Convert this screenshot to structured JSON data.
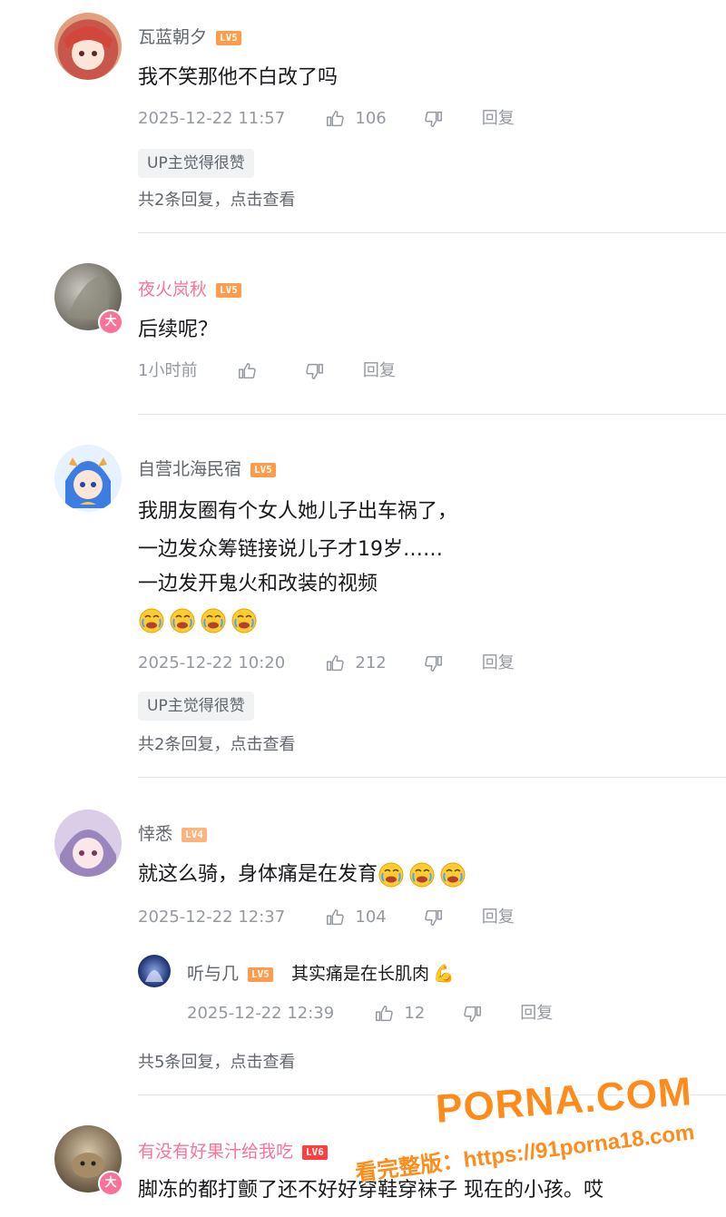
{
  "comments": [
    {
      "username": "瓦蓝朝夕",
      "level": "LV5",
      "text": "我不笑那他不白改了吗",
      "time": "2025-12-22 11:57",
      "likes": "106",
      "reply_label": "回复",
      "up_tag": "UP主觉得很赞",
      "more": "共2条回复，点击查看"
    },
    {
      "username": "夜火岚秋",
      "level": "LV5",
      "text": "后续呢？",
      "time": "1小时前",
      "reply_label": "回复",
      "badge": "大"
    },
    {
      "username": "自营北海民宿",
      "level": "LV5",
      "lines": [
        "我朋友圈有个女人她儿子出车祸了，",
        "一边发众筹链接说儿子才19岁……",
        "一边发开鬼火和改装的视频"
      ],
      "time": "2025-12-22 10:20",
      "likes": "212",
      "reply_label": "回复",
      "up_tag": "UP主觉得很赞",
      "more": "共2条回复，点击查看"
    },
    {
      "username": "悻悉",
      "level": "LV4",
      "text": "就这么骑，身体痛是在发育",
      "time": "2025-12-22 12:37",
      "likes": "104",
      "reply_label": "回复",
      "reply": {
        "username": "听与几",
        "level": "LV5",
        "text": "其实痛是在长肌肉",
        "time": "2025-12-22 12:39",
        "likes": "12",
        "reply_label": "回复"
      },
      "more": "共5条回复，点击查看"
    },
    {
      "username": "有没有好果汁给我吃",
      "level": "LV6",
      "badge": "大",
      "text": "脚冻的都打颤了还不好好穿鞋穿袜子 现在的小孩。哎"
    }
  ],
  "watermark": {
    "brand": "PORNA.COM",
    "url_line": "看完整版：https://91porna18.com"
  },
  "colors": {
    "pink": "#fb7299",
    "gray": "#9499a0",
    "lv5": "#ff9b4a",
    "watermark": "#ff8c1a"
  },
  "icons": [
    "like-icon",
    "dislike-icon",
    "reaction-emoji",
    "muscle-emoji"
  ]
}
